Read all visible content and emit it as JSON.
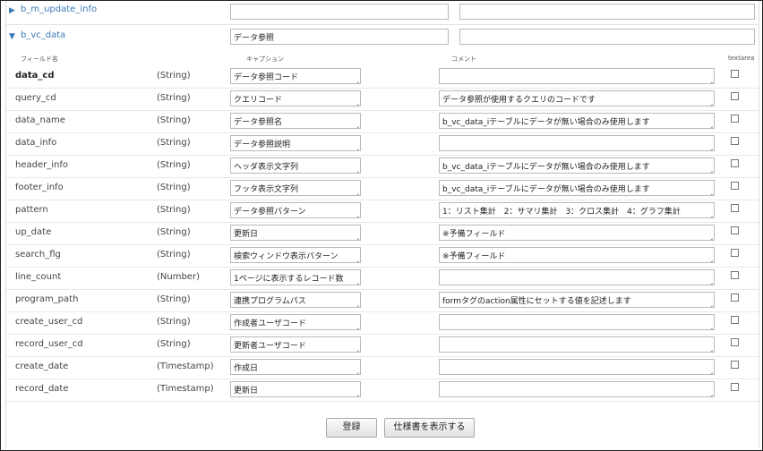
{
  "sections": [
    {
      "label": "b_m_update_info",
      "caption": "",
      "comment": "",
      "expanded": false
    },
    {
      "label": "b_vc_data",
      "caption": "データ参照",
      "comment": "",
      "expanded": true
    }
  ],
  "headers": {
    "field": "フィールド名",
    "caption": "キャプション",
    "comment": "コメント",
    "textarea": "textarea"
  },
  "rows": [
    {
      "name": "data_cd",
      "type": "(String)",
      "caption": "データ参照コード",
      "comment": "",
      "bold": true
    },
    {
      "name": "query_cd",
      "type": "(String)",
      "caption": "クエリコード",
      "comment": "データ参照が使用するクエリのコードです"
    },
    {
      "name": "data_name",
      "type": "(String)",
      "caption": "データ参照名",
      "comment": "b_vc_data_iテーブルにデータが無い場合のみ使用します"
    },
    {
      "name": "data_info",
      "type": "(String)",
      "caption": "データ参照説明",
      "comment": ""
    },
    {
      "name": "header_info",
      "type": "(String)",
      "caption": "ヘッダ表示文字列",
      "comment": "b_vc_data_iテーブルにデータが無い場合のみ使用します"
    },
    {
      "name": "footer_info",
      "type": "(String)",
      "caption": "フッタ表示文字列",
      "comment": "b_vc_data_iテーブルにデータが無い場合のみ使用します"
    },
    {
      "name": "pattern",
      "type": "(String)",
      "caption": "データ参照パターン",
      "comment": "1：リスト集計　2：サマリ集計　3：クロス集計　4：グラフ集計"
    },
    {
      "name": "up_date",
      "type": "(String)",
      "caption": "更新日",
      "comment": "※予備フィールド"
    },
    {
      "name": "search_flg",
      "type": "(String)",
      "caption": "検索ウィンドウ表示パターン",
      "comment": "※予備フィールド"
    },
    {
      "name": "line_count",
      "type": "(Number)",
      "caption": "1ページに表示するレコード数",
      "comment": ""
    },
    {
      "name": "program_path",
      "type": "(String)",
      "caption": "連携プログラムパス",
      "comment": "formタグのaction属性にセットする値を記述します"
    },
    {
      "name": "create_user_cd",
      "type": "(String)",
      "caption": "作成者ユーザコード",
      "comment": ""
    },
    {
      "name": "record_user_cd",
      "type": "(String)",
      "caption": "更新者ユーザコード",
      "comment": ""
    },
    {
      "name": "create_date",
      "type": "(Timestamp)",
      "caption": "作成日",
      "comment": ""
    },
    {
      "name": "record_date",
      "type": "(Timestamp)",
      "caption": "更新日",
      "comment": ""
    }
  ],
  "buttons": {
    "register": "登録",
    "show_spec": "仕様書を表示する"
  }
}
